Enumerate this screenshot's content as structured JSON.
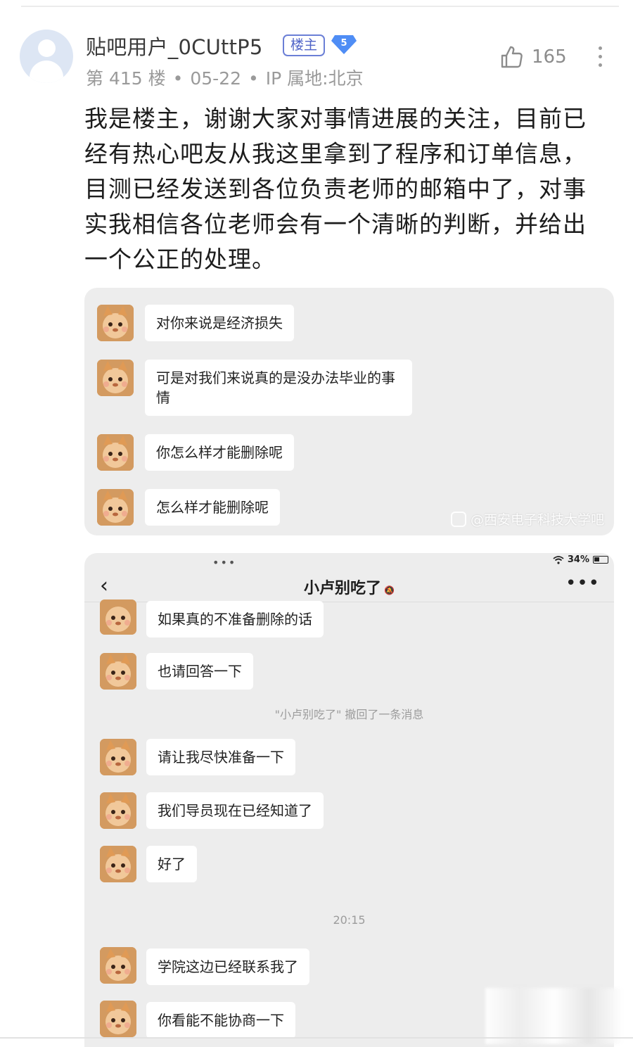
{
  "post": {
    "username": "贴吧用户_0CUttP5",
    "op_badge": "楼主",
    "level": "5",
    "floor": "第 415 楼",
    "date": "05-22",
    "ip_location": "IP 属地:北京",
    "like_count": "165",
    "body": "我是楼主，谢谢大家对事情进展的关注，目前已经有热心吧友从我这里拿到了程序和订单信息，目测已经发送到各位负责老师的邮箱中了，对事实我相信各位老师会有一个清晰的判断，并给出一个公正的处理。"
  },
  "screenshot1": {
    "messages": [
      "对你来说是经济损失",
      "可是对我们来说真的是没办法毕业的事情",
      "你怎么样才能删除呢",
      "怎么样才能删除呢"
    ],
    "watermark": "@西安电子科技大学吧"
  },
  "screenshot2": {
    "status_dots": "•••",
    "battery": "34%",
    "chat_title": "小卢别吃了",
    "back_icon": "‹",
    "menu_icon": "•••",
    "messages_a": [
      "如果真的不准备删除的话",
      "也请回答一下"
    ],
    "recall_notice": "\"小卢别吃了\" 撤回了一条消息",
    "messages_b": [
      "请让我尽快准备一下",
      "我们导员现在已经知道了",
      "好了"
    ],
    "timestamp": "20:15",
    "messages_c": [
      "学院这边已经联系我了",
      "你看能不能协商一下"
    ]
  },
  "colors": {
    "accent": "#5064c8",
    "level_badge": "#4f8df5",
    "chat_bg": "#ededed"
  },
  "icons": {
    "like": "thumbs-up-icon",
    "more": "vertical-dots-icon",
    "back": "chevron-left-icon",
    "wifi": "wifi-icon",
    "battery": "battery-icon"
  }
}
